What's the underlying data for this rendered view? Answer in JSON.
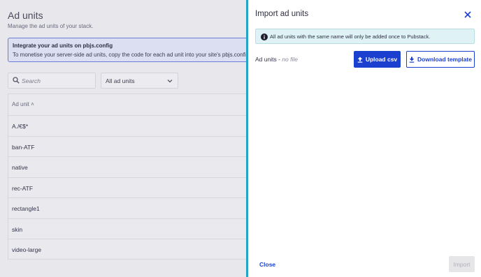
{
  "page": {
    "title": "Ad units",
    "subtitle": "Manage the ad units of your stack.",
    "banner": {
      "title": "Integrate your ad units on pbjs.config",
      "text": "To monetise your server-side ad units, copy the code for each ad unit into your site's pbjs.config. You"
    },
    "search": {
      "placeholder": "Search"
    },
    "filter": {
      "selected": "All ad units"
    },
    "table": {
      "column_header": "Ad unit",
      "sort_indicator": "˄",
      "rows": [
        "A./€$*",
        "ban-ATF",
        "native",
        "rec-ATF",
        "rectangle1",
        "skin",
        "video-large"
      ]
    }
  },
  "drawer": {
    "title": "Import ad units",
    "notice": "All ad units with the same name will only be added once to Pubstack.",
    "file_label": "Ad units",
    "file_separator": " - ",
    "file_status": "no file",
    "upload_label": "Upload csv",
    "download_label": "Download template",
    "close_label": "Close",
    "import_label": "Import"
  },
  "colors": {
    "accent": "#1b3fcf",
    "drawer_edge": "#23a6c5",
    "notice_bg": "#dff3f7"
  }
}
